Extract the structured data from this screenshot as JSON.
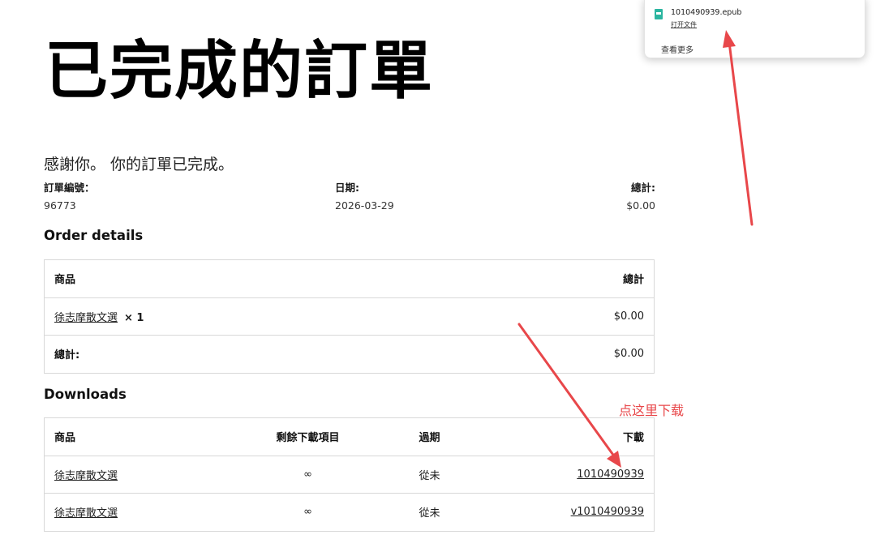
{
  "page": {
    "title": "已完成的訂單",
    "thanks": "感謝你。 你的訂單已完成。"
  },
  "overview": {
    "order_number_label": "訂單編號：",
    "order_number": "96773",
    "date_label": "日期:",
    "date": "2026-03-29",
    "total_label": "總計:",
    "total": "$0.00"
  },
  "order_details": {
    "heading": "Order details",
    "header_product": "商品",
    "header_total": "總計",
    "items": [
      {
        "name": "徐志摩散文選",
        "qty": "× 1",
        "total": "$0.00"
      }
    ],
    "footer_label": "總計:",
    "footer_total": "$0.00"
  },
  "downloads": {
    "heading": "Downloads",
    "headers": [
      "商品",
      "剩餘下載項目",
      "過期",
      "下載"
    ],
    "rows": [
      {
        "product": "徐志摩散文選",
        "remaining": "∞",
        "expires": "從未",
        "file": "1010490939"
      },
      {
        "product": "徐志摩散文選",
        "remaining": "∞",
        "expires": "從未",
        "file": "v1010490939"
      }
    ]
  },
  "download_popup": {
    "file_name": "1010490939.epub",
    "open_file": "打开文件",
    "see_more": "查看更多",
    "icon": "epub-file-icon",
    "icon_color": "#2bb5a0"
  },
  "annotation": {
    "text": "点这里下载",
    "color": "#e8474a"
  }
}
